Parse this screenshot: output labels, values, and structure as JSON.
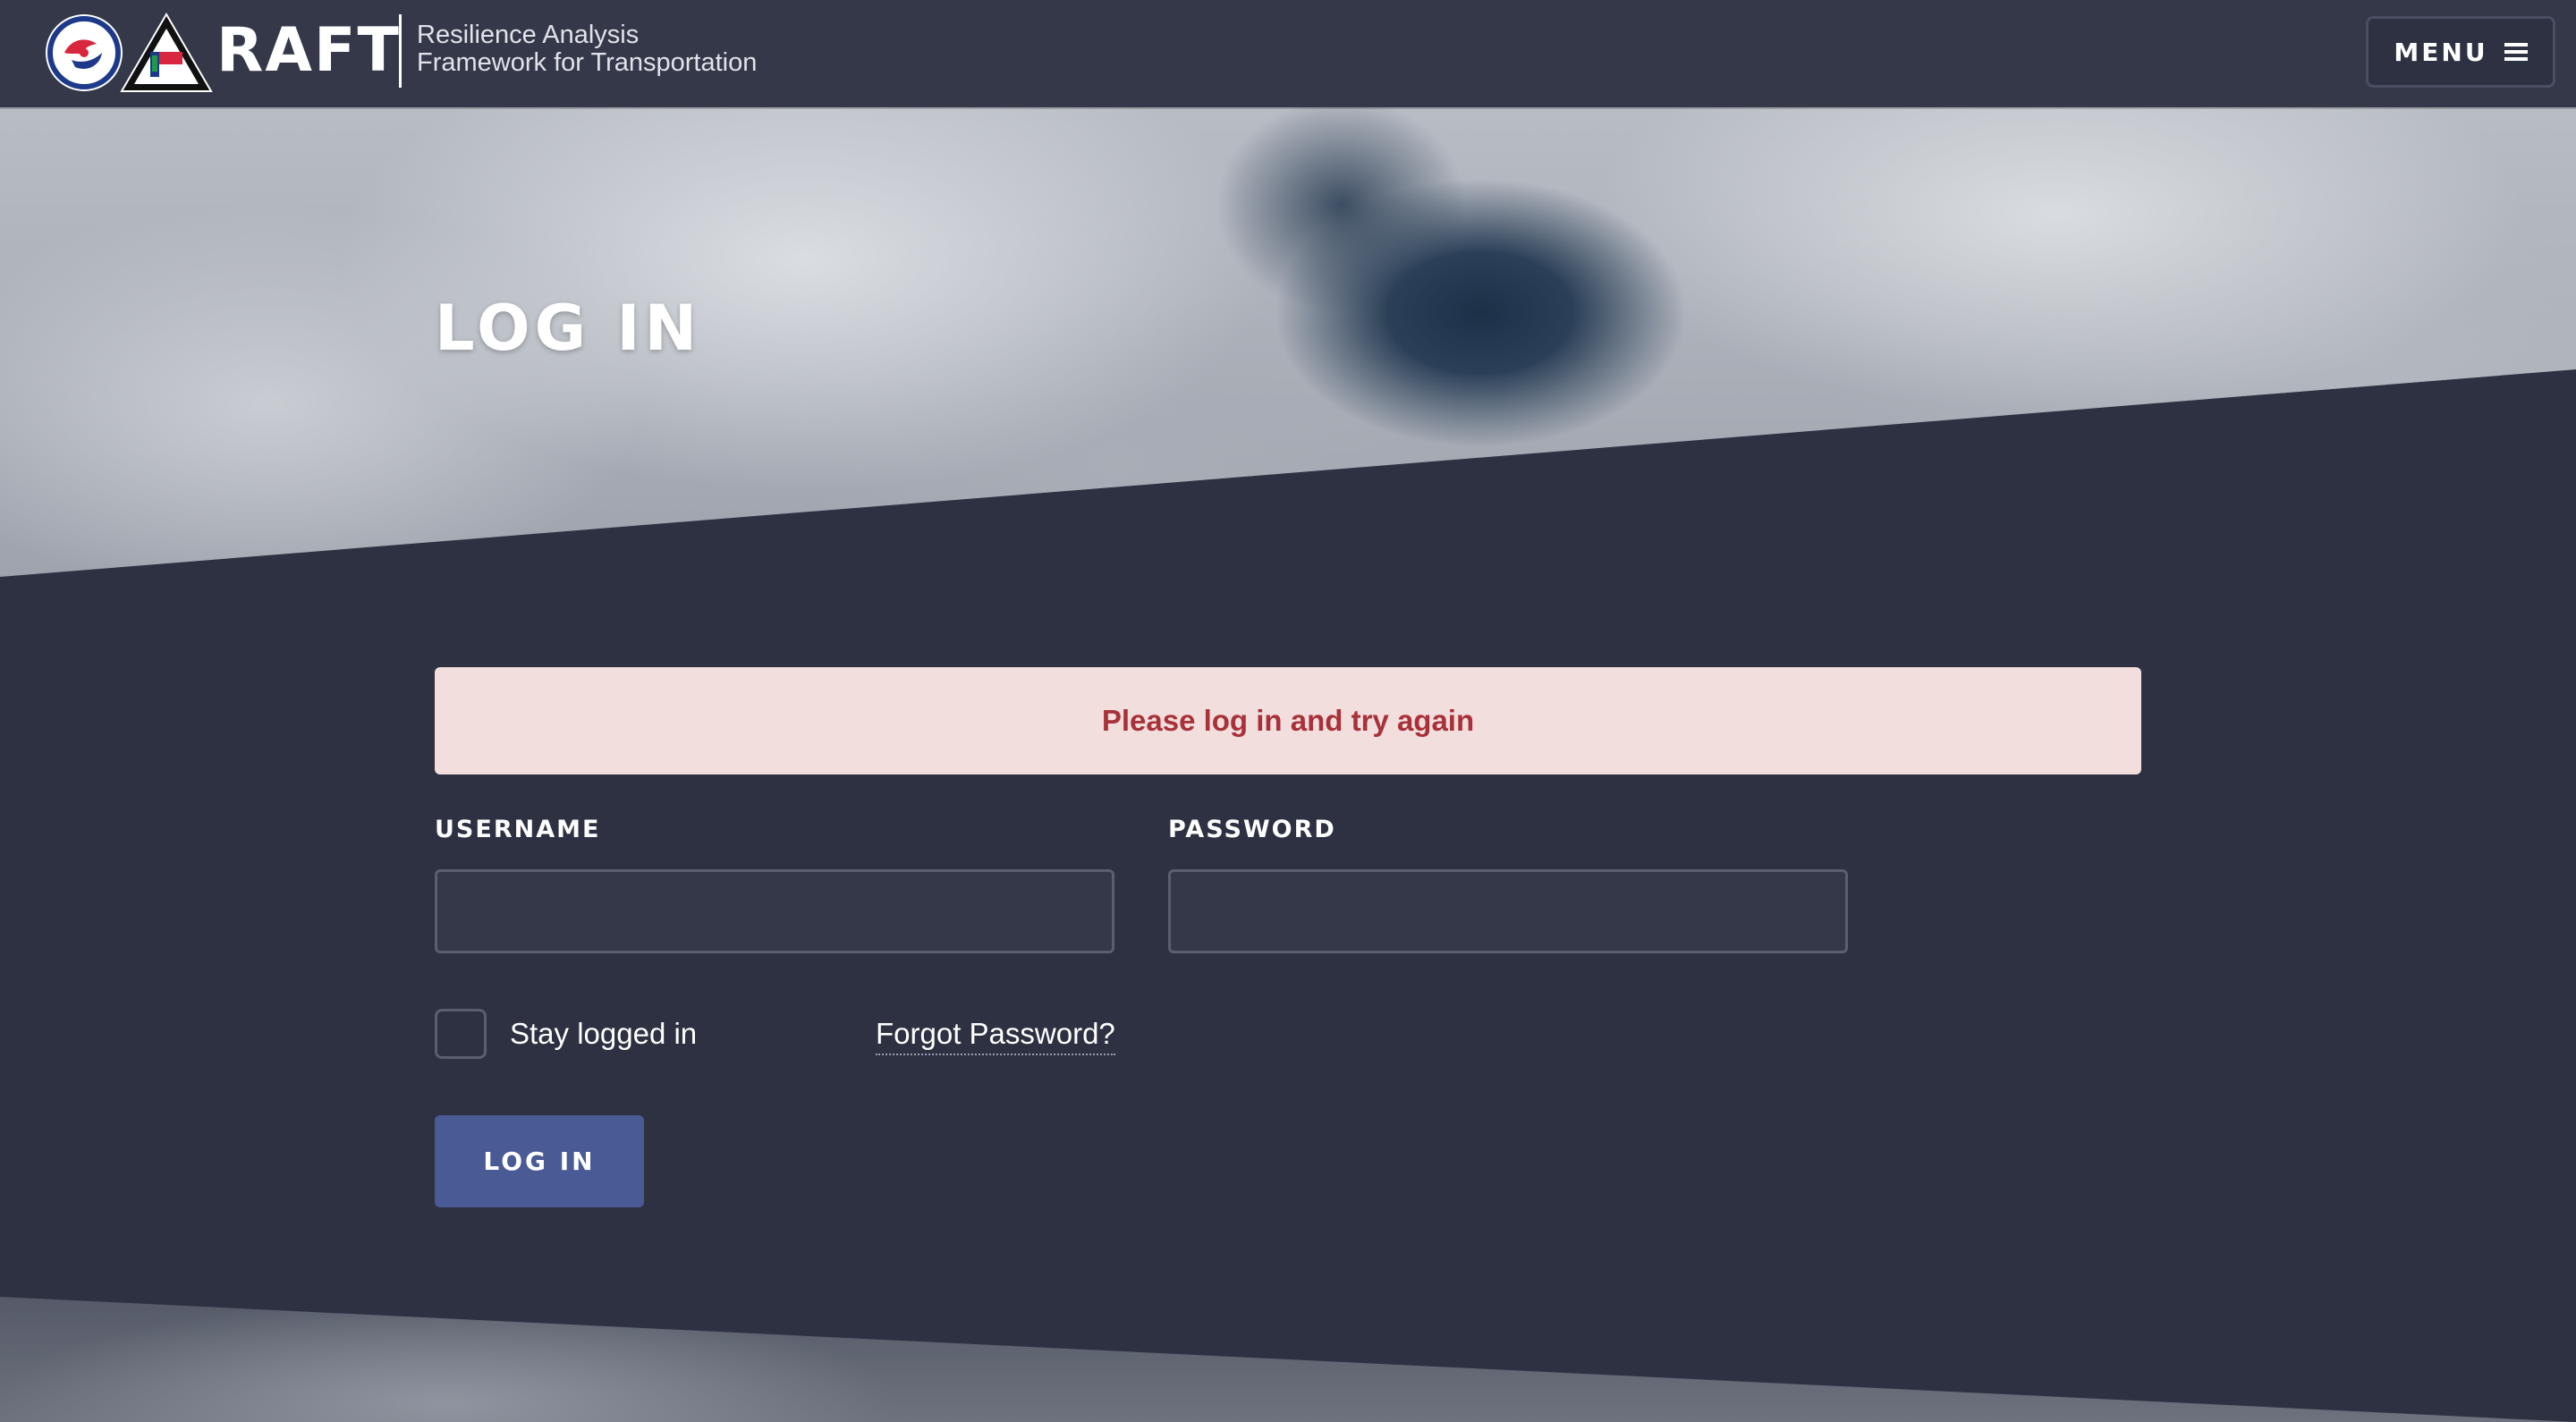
{
  "header": {
    "brand_name": "RAFT",
    "tagline_line1": "Resilience Analysis",
    "tagline_line2": "Framework for Transportation",
    "menu_label": "MENU",
    "menu_icon": "hamburger-icon"
  },
  "hero": {
    "title": "LOG IN"
  },
  "alert": {
    "message": "Please log in and try again",
    "color": "#a8323a",
    "background": "#f2dedd"
  },
  "form": {
    "username_label": "USERNAME",
    "username_value": "",
    "password_label": "PASSWORD",
    "password_value": "",
    "stay_logged_in_label": "Stay logged in",
    "stay_logged_in_checked": false,
    "forgot_password_label": "Forgot Password?",
    "submit_label": "LOG IN"
  },
  "colors": {
    "page_background": "#2e3142",
    "header_background": "#343849",
    "button_background": "#4a5a94"
  }
}
